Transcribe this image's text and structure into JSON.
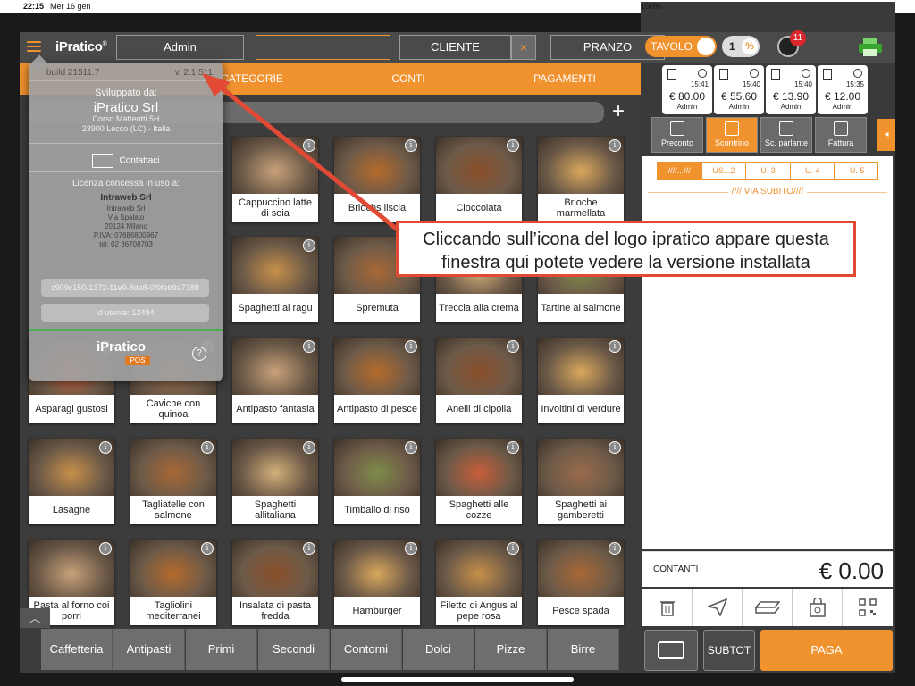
{
  "status": {
    "time": "22:15",
    "date": "Mer 16 gen",
    "battery": "100%"
  },
  "topbar": {
    "logo": "iPratico",
    "operator": "Admin",
    "field_empty": "",
    "cliente": "CLIENTE",
    "clear": "×",
    "service": "PRANZO",
    "tavolo": "TAVOLO",
    "covers": "1",
    "percent": "%",
    "notifications": "11"
  },
  "tabs": [
    "CATEGORIE",
    "CONTI",
    "PAGAMENTI"
  ],
  "products": [
    [
      "Cappuccino latte di soia",
      "Briochs liscia",
      "Cioccolata",
      "Brioche marmellata"
    ],
    [
      "Spaghetti al ragu",
      "Spremuta",
      "Treccia alla crema",
      "Tartine al salmone"
    ],
    [
      "Asparagi gustosi",
      "Caviche con quinoa",
      "Antipasto fantasia",
      "Antipasto di pesce",
      "Anelli di cipolla",
      "Involtini di verdure"
    ],
    [
      "Lasagne",
      "Tagliatelle con salmone",
      "Spaghetti allitaliana",
      "Timballo di riso",
      "Spaghetti alle cozze",
      "Spaghetti ai gamberetti"
    ],
    [
      "Pasta al forno coi porri",
      "Tagliolini mediterranei",
      "Insalata di pasta fredda",
      "Hamburger",
      "Filetto di Angus al pepe rosa",
      "Pesce spada"
    ]
  ],
  "categories": [
    "Caffetteria",
    "Antipasti",
    "Primi",
    "Secondi",
    "Contorni",
    "Dolci",
    "Pizze",
    "Birre"
  ],
  "popover": {
    "build": "build 21511.7",
    "version": "v. 2.1.511",
    "developed_by": "Sviluppato da:",
    "company": "iPratico Srl",
    "address1": "Corso Matteotti 5H",
    "address2": "23900 Lecco (LC) - Italia",
    "contact": "Contattaci",
    "license_label": "Licenza concessa in uso a:",
    "licensee": "Intraweb Srl",
    "lic1": "Intraweb Srl",
    "lic2": "Via Spalato",
    "lic3": "20124 Milano",
    "lic4": "P.IVA: 07686800967",
    "lic5": "tel: 02 36708703",
    "device_id": "c909c150-1372-11e9-8da8-0f9feb9a7388",
    "user_id": "Id utente: 12494",
    "logo": "iPratico",
    "pos": "POS",
    "help": "?"
  },
  "tickets": [
    {
      "time": "15:41",
      "amount": "€ 80.00",
      "user": "Admin"
    },
    {
      "time": "15:40",
      "amount": "€ 55.60",
      "user": "Admin"
    },
    {
      "time": "15:40",
      "amount": "€ 13.90",
      "user": "Admin"
    },
    {
      "time": "15:35",
      "amount": "€ 12.00",
      "user": "Admin"
    }
  ],
  "doc_buttons": [
    "Preconto",
    "Scontrino",
    "Sc. parlante",
    "Fattura"
  ],
  "user_tabs": [
    "////...///",
    "US...2",
    "U. 3",
    "U. 4",
    "U. 5"
  ],
  "via_subito": "//// VIA SUBITO////",
  "payment": {
    "label": "CONTANTI",
    "total": "€ 0.00"
  },
  "bottom": {
    "subtot": "SUBTOT",
    "paga": "PAGA"
  },
  "callout": {
    "line1": "Cliccando sull’icona del logo ipratico appare questa",
    "line2": "finestra qui potete vedere la versione installata"
  },
  "colors": {
    "accent": "#f0922e",
    "callout_border": "#e24a35"
  }
}
